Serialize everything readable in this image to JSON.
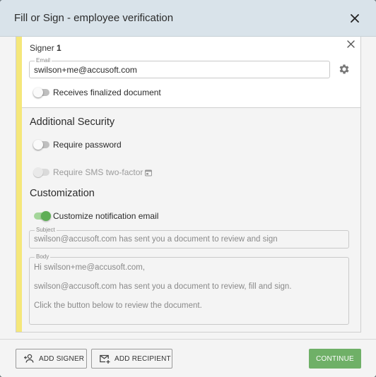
{
  "dialog": {
    "title": "Fill or Sign - employee verification"
  },
  "signer": {
    "label_prefix": "Signer",
    "number": "1",
    "email_legend": "Email",
    "email_value": "swilson+me@accusoft.com",
    "receives_finalized_label": "Receives finalized document",
    "receives_finalized_on": false
  },
  "security": {
    "title": "Additional Security",
    "require_password_label": "Require password",
    "require_password_on": false,
    "require_sms_label": "Require SMS two-factor",
    "require_sms_on": false,
    "require_sms_disabled": true
  },
  "customization": {
    "title": "Customization",
    "customize_email_label": "Customize notification email",
    "customize_email_on": true,
    "subject_legend": "Subject",
    "subject_value": "swilson@accusoft.com has sent you a document to review and sign",
    "body_legend": "Body",
    "body_lines": [
      "Hi swilson+me@accusoft.com,",
      "swilson@accusoft.com has sent you a document to review, fill and sign.",
      "Click the button below to review the document."
    ]
  },
  "footer": {
    "add_signer_label": "ADD SIGNER",
    "add_recipient_label": "ADD RECIPIENT",
    "continue_label": "CONTINUE"
  },
  "colors": {
    "header_bg": "#d9e3ea",
    "accent_yellow": "#f5e77a",
    "continue_green": "#6fb067",
    "toggle_on_green": "#5fae56"
  },
  "icons": {
    "close": "close-icon",
    "gear": "gear-icon",
    "sms_info": "info-card-icon",
    "add_signer": "add-person-icon",
    "add_recipient": "mail-plus-icon"
  }
}
